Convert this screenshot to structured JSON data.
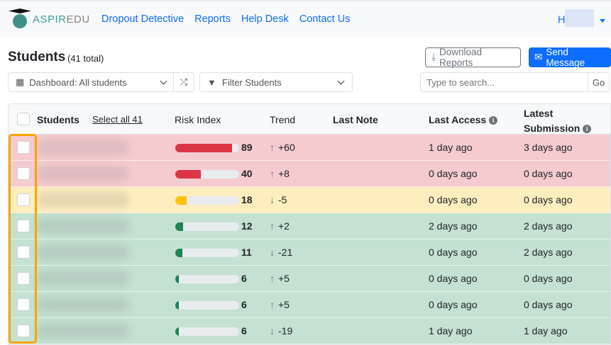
{
  "nav": {
    "logo": {
      "brand_a": "ASPIR",
      "brand_b": "EDU"
    },
    "links": [
      "Dropout Detective",
      "Reports",
      "Help Desk",
      "Contact Us"
    ],
    "user_initial": "H"
  },
  "page": {
    "title": "Students",
    "total": "(41 total)",
    "download_label": "Download Reports",
    "send_label": "Send Message"
  },
  "controls": {
    "dashboard": "Dashboard: All students",
    "filter": "Filter Students",
    "search_placeholder": "Type to search...",
    "go": "Go"
  },
  "table": {
    "headers": {
      "students": "Students",
      "select_all": "Select all 41",
      "risk": "Risk Index",
      "trend": "Trend",
      "last_note": "Last Note",
      "last_access": "Last Access",
      "latest_submission": "Latest Submission"
    },
    "rows": [
      {
        "risk": 89,
        "level": "red",
        "trend": "+60",
        "dir": "up",
        "access": "1 day ago",
        "submission": "3 days ago"
      },
      {
        "risk": 40,
        "level": "red",
        "trend": "+8",
        "dir": "up",
        "access": "0 days ago",
        "submission": "0 days ago"
      },
      {
        "risk": 18,
        "level": "yellow",
        "trend": "-5",
        "dir": "down",
        "access": "0 days ago",
        "submission": "0 days ago"
      },
      {
        "risk": 12,
        "level": "green",
        "trend": "+2",
        "dir": "up",
        "access": "2 days ago",
        "submission": "2 days ago"
      },
      {
        "risk": 11,
        "level": "green",
        "trend": "-21",
        "dir": "down",
        "access": "0 days ago",
        "submission": "2 days ago"
      },
      {
        "risk": 6,
        "level": "green",
        "trend": "+5",
        "dir": "up",
        "access": "0 days ago",
        "submission": "0 days ago"
      },
      {
        "risk": 6,
        "level": "green",
        "trend": "+5",
        "dir": "up",
        "access": "0 days ago",
        "submission": "0 days ago"
      },
      {
        "risk": 6,
        "level": "green",
        "trend": "-19",
        "dir": "down",
        "access": "1 day ago",
        "submission": "1 day ago"
      }
    ]
  },
  "colors": {
    "red": "#dc3545",
    "yellow": "#ffc107",
    "green": "#198754",
    "primary": "#0d6efd",
    "highlight": "#f6a600"
  }
}
